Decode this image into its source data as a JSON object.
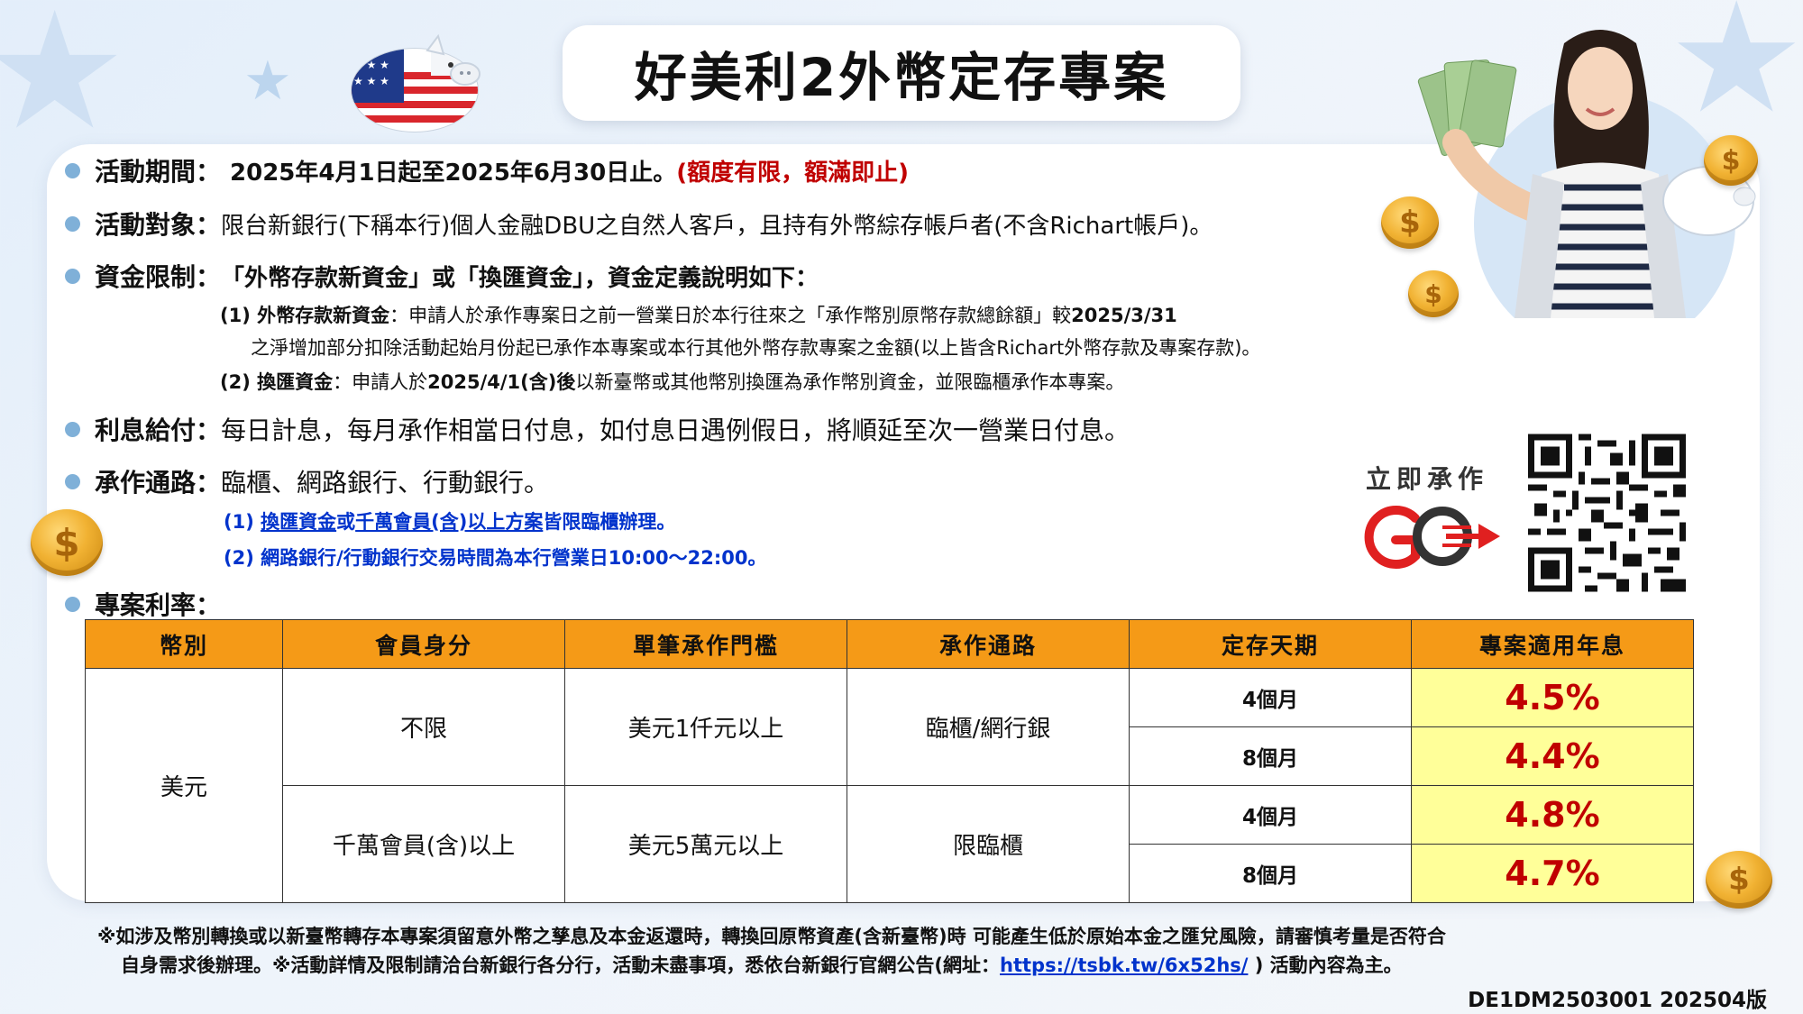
{
  "title": "好美利2外幣定存專案",
  "bullets": {
    "period_label": "活動期間：",
    "period_value": "2025年4月1日起至2025年6月30日止。",
    "period_note": "(額度有限，額滿即止)",
    "target_label": "活動對象：",
    "target_value": "限台新銀行(下稱本行)個人金融DBU之自然人客戶，且持有外幣綜存帳戶者(不含Richart帳戶)。",
    "fund_label": "資金限制：",
    "fund_value": "「外幣存款新資金」或「換匯資金」，資金定義說明如下：",
    "fund_sub1_label": "(1) 外幣存款新資金",
    "fund_sub1_text": "：申請人於承作專案日之前一營業日於本行往來之「承作幣別原幣存款總餘額」較",
    "fund_sub1_date": "2025/3/31",
    "fund_sub1_line2": "之淨增加部分扣除活動起始月份起已承作本專案或本行其他外幣存款專案之金額(以上皆含Richart外幣存款及專案存款)。",
    "fund_sub2_label": "(2) 換匯資金",
    "fund_sub2_text_a": "：申請人於",
    "fund_sub2_date": "2025/4/1(含)後",
    "fund_sub2_text_b": "以新臺幣或其他幣別換匯為承作幣別資金，並限臨櫃承作本專案。",
    "interest_label": "利息給付：",
    "interest_value": "每日計息，每月承作相當日付息，如付息日遇例假日，將順延至次一營業日付息。",
    "channel_label": "承作通路：",
    "channel_value": "臨櫃、網路銀行、行動銀行。",
    "channel_note1_a": "(1) ",
    "channel_note1_b": "換匯資金",
    "channel_note1_c": "或",
    "channel_note1_d": "千萬會員(含)以上方案",
    "channel_note1_e": "皆限臨櫃辦理。",
    "channel_note2": "(2) 網路銀行/行動銀行交易時間為本行營業日10:00～22:00。",
    "rate_label": "專案利率："
  },
  "go_label": "立即承作",
  "table": {
    "headers": [
      "幣別",
      "會員身分",
      "單筆承作門檻",
      "承作通路",
      "定存天期",
      "專案適用年息"
    ],
    "currency": "美元",
    "groups": [
      {
        "member": "不限",
        "threshold": "美元1仟元以上",
        "channel": "臨櫃/網行銀",
        "terms": [
          {
            "term": "4個月",
            "rate": "4.5%"
          },
          {
            "term": "8個月",
            "rate": "4.4%"
          }
        ]
      },
      {
        "member": "千萬會員(含)以上",
        "threshold": "美元5萬元以上",
        "channel": "限臨櫃",
        "terms": [
          {
            "term": "4個月",
            "rate": "4.8%"
          },
          {
            "term": "8個月",
            "rate": "4.7%"
          }
        ]
      }
    ]
  },
  "footnote": {
    "line1": "※如涉及幣別轉換或以新臺幣轉存本專案須留意外幣之孳息及本金返還時，轉換回原幣資產(含新臺幣)時 可能產生低於原始本金之匯兌風險，請審慎考量是否符合",
    "line2_a": "自身需求後辦理。※活動詳情及限制請洽台新銀行各分行，活動未盡事項，悉依台新銀行官網公告(網址：",
    "line2_link": "https://tsbk.tw/6x52hs/",
    "line2_b": " ) 活動內容為主。"
  },
  "doc_code": "DE1DM2503001  202504版",
  "icons": [
    "piggy-bank-flag-icon",
    "coin-icon",
    "qr-code-icon",
    "go-arrow-icon",
    "star-icon",
    "woman-holding-cash-image"
  ],
  "colors": {
    "header_orange": "#f59a17",
    "rate_highlight": "#ffff99",
    "rate_red": "#c00000",
    "link_blue": "#0033cc",
    "bullet_blue": "#7fb0d8"
  }
}
